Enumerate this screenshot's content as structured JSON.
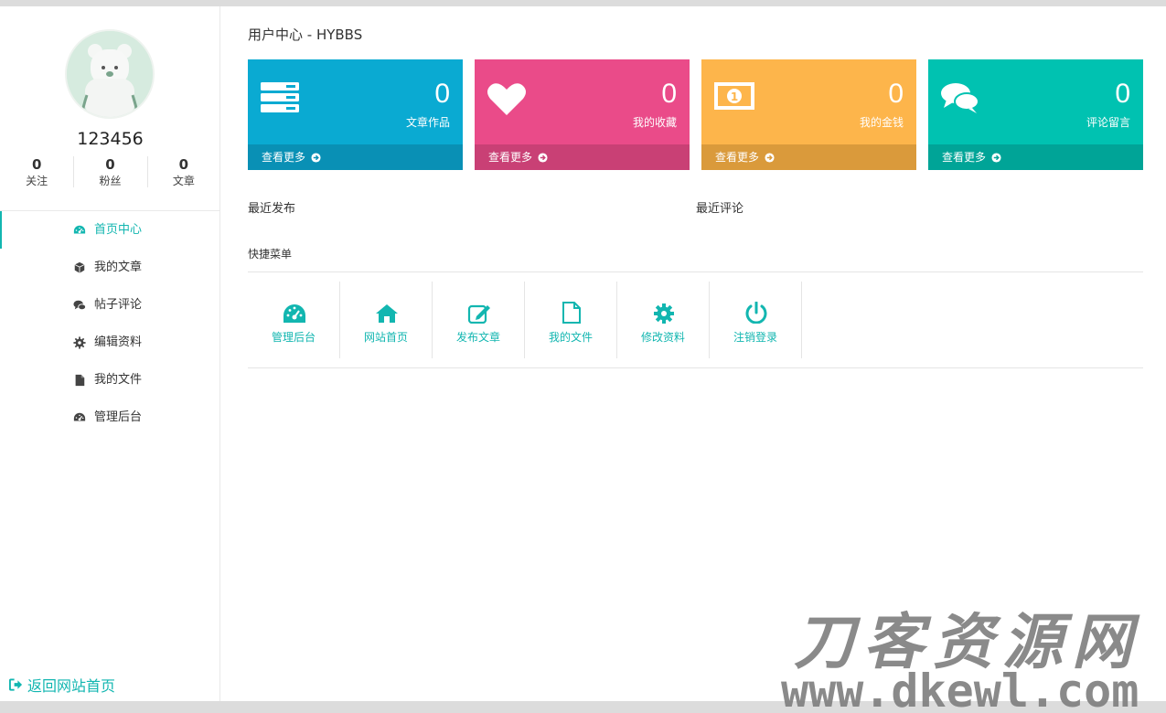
{
  "page_title": "用户中心 - HYBBS",
  "user": {
    "name": "123456",
    "stats": [
      {
        "num": "0",
        "label": "关注"
      },
      {
        "num": "0",
        "label": "粉丝"
      },
      {
        "num": "0",
        "label": "文章"
      }
    ]
  },
  "sidebar": {
    "items": [
      {
        "label": "首页中心",
        "icon": "dashboard-icon",
        "active": true
      },
      {
        "label": "我的文章",
        "icon": "cube-icon"
      },
      {
        "label": "帖子评论",
        "icon": "comments-icon"
      },
      {
        "label": "编辑资料",
        "icon": "gear-icon"
      },
      {
        "label": "我的文件",
        "icon": "file-icon"
      },
      {
        "label": "管理后台",
        "icon": "dashboard-icon"
      }
    ],
    "back_home": "返回网站首页"
  },
  "cards": [
    {
      "num": "0",
      "label": "文章作品",
      "more": "查看更多",
      "icon": "server-icon",
      "color": "#0aaad2",
      "foot_color": "#0990b5"
    },
    {
      "num": "0",
      "label": "我的收藏",
      "more": "查看更多",
      "icon": "heart-icon",
      "color": "#ea4b89",
      "foot_color": "#c94075"
    },
    {
      "num": "0",
      "label": "我的金钱",
      "more": "查看更多",
      "icon": "money-icon",
      "color": "#fdb54b",
      "foot_color": "#da9a3b"
    },
    {
      "num": "0",
      "label": "评论留言",
      "more": "查看更多",
      "icon": "comments-icon",
      "color": "#00c2b1",
      "foot_color": "#00a497"
    }
  ],
  "sections": {
    "recent_posts": "最近发布",
    "recent_comments": "最近评论",
    "quick_menu": "快捷菜单"
  },
  "quick_menu": [
    {
      "label": "管理后台",
      "icon": "dashboard-icon"
    },
    {
      "label": "网站首页",
      "icon": "home-icon"
    },
    {
      "label": "发布文章",
      "icon": "edit-icon"
    },
    {
      "label": "我的文件",
      "icon": "file-outline-icon"
    },
    {
      "label": "修改资料",
      "icon": "gear-icon"
    },
    {
      "label": "注销登录",
      "icon": "power-icon"
    }
  ],
  "watermark": {
    "line1": "刀客资源网",
    "line2": "www.dkewl.com"
  },
  "colors": {
    "accent": "#12b6b0"
  }
}
